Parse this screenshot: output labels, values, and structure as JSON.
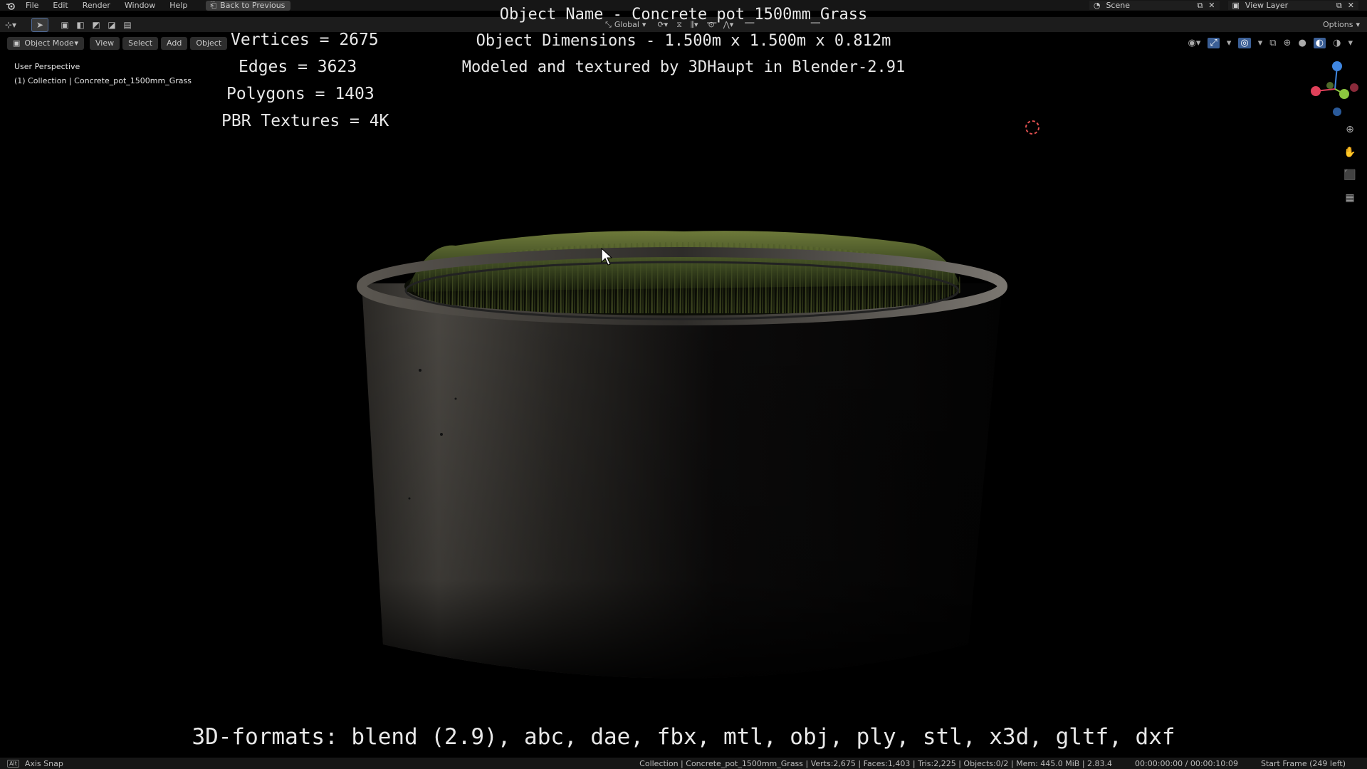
{
  "menu": {
    "items": [
      "File",
      "Edit",
      "Render",
      "Window",
      "Help"
    ],
    "back_button": "Back to Previous"
  },
  "header": {
    "scene": "Scene",
    "view_layer": "View Layer",
    "transform_orientation": "Global",
    "options": "Options"
  },
  "viewport_header": {
    "mode": "Object Mode",
    "view": "View",
    "select": "Select",
    "add": "Add",
    "object": "Object"
  },
  "viewport_info": {
    "perspective": "User Perspective",
    "collection": "(1) Collection | Concrete_pot_1500mm_Grass"
  },
  "overlay_text": {
    "object_name": "Object Name - Concrete_pot_1500mm_Grass",
    "vertices": "Vertices = 2675",
    "edges": "Edges = 3623",
    "polygons": "Polygons = 1403",
    "pbr_textures": "PBR Textures = 4K",
    "dimensions": "Object Dimensions -  1.500m x 1.500m x 0.812m",
    "credit": "Modeled and textured by 3DHaupt in Blender-2.91",
    "formats": "3D-formats: blend (2.9), abc, dae, fbx, mtl, obj, ply, stl, x3d, gltf, dxf"
  },
  "statusbar": {
    "axis_snap": "Axis Snap",
    "stats": "Collection | Concrete_pot_1500mm_Grass | Verts:2,675 | Faces:1,403 | Tris:2,225 | Objects:0/2 | Mem: 445.0 MiB | 2.83.4",
    "time": "00:00:00:00 / 00:00:10:09",
    "frame": "Start Frame (249 left)"
  },
  "colors": {
    "background": "#000000",
    "ui_dark": "#161616",
    "text_overlay": "#e8e8e8",
    "axis_x": "#e0415a",
    "axis_y": "#8cc63f",
    "axis_z": "#3f86e0"
  }
}
